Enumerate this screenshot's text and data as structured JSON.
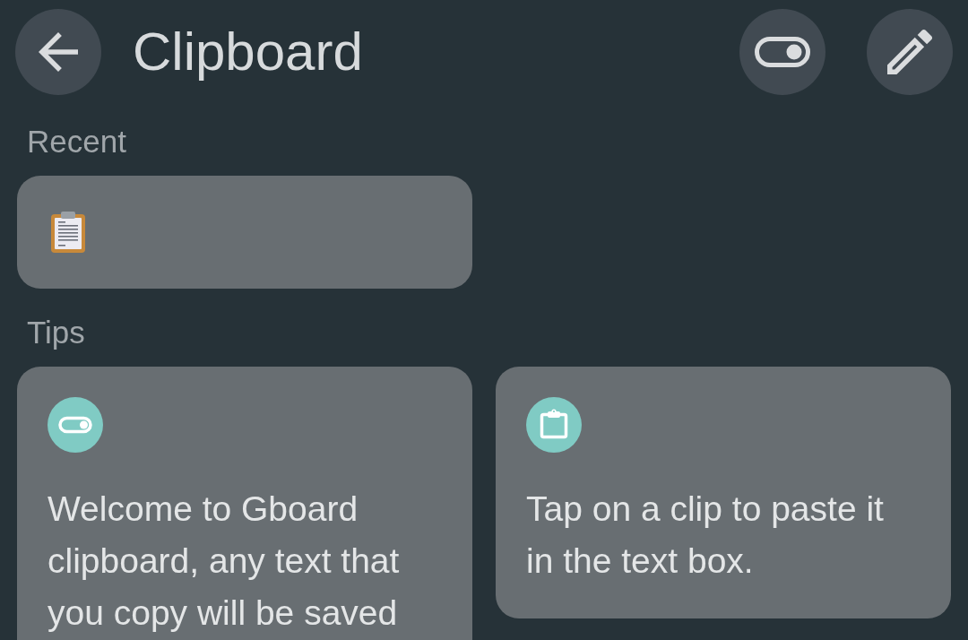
{
  "header": {
    "title": "Clipboard"
  },
  "recent": {
    "heading": "Recent",
    "clips": [
      {
        "kind": "emoji"
      }
    ]
  },
  "tips": {
    "heading": "Tips",
    "cards": [
      {
        "kind": "toggle",
        "text": "Welcome to Gboard clipboard, any text that you copy will be saved"
      },
      {
        "kind": "clipboard",
        "text": "Tap on a clip to paste it in the text box."
      }
    ]
  }
}
